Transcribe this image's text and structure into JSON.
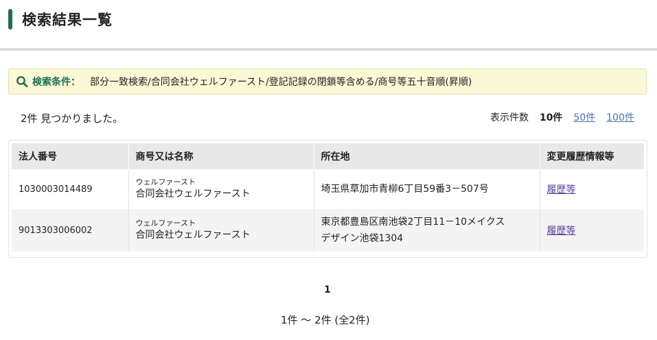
{
  "page": {
    "title": "検索結果一覧"
  },
  "conditions": {
    "label": "検索条件：",
    "value": "部分一致検索/合同会社ウェルファースト/登記記録の閉鎖等含める/商号等五十音順(昇順)",
    "icon": "search-icon",
    "accent_color": "#1e6e52"
  },
  "results": {
    "count_text": "2件 見つかりました。",
    "per_page_label": "表示件数",
    "per_page_current": "10件",
    "per_page_options": [
      "50件",
      "100件"
    ]
  },
  "table": {
    "headers": [
      "法人番号",
      "商号又は名称",
      "所在地",
      "変更履歴情報等"
    ],
    "rows": [
      {
        "corp_number": "1030003014489",
        "name_kana": "ウェルファースト",
        "name": "合同会社ウェルファースト",
        "address_line1": "埼玉県草加市青柳6丁目59番3－507号",
        "address_line2": "",
        "history_link": "履歴等"
      },
      {
        "corp_number": "9013303006002",
        "name_kana": "ウェルファースト",
        "name": "合同会社ウェルファースト",
        "address_line1": "東京都豊島区南池袋2丁目11－10メイクス",
        "address_line2": "デザイン池袋1304",
        "history_link": "履歴等"
      }
    ]
  },
  "pagination": {
    "current_page": "1",
    "range_text": "1件 ～ 2件 (全2件)"
  }
}
